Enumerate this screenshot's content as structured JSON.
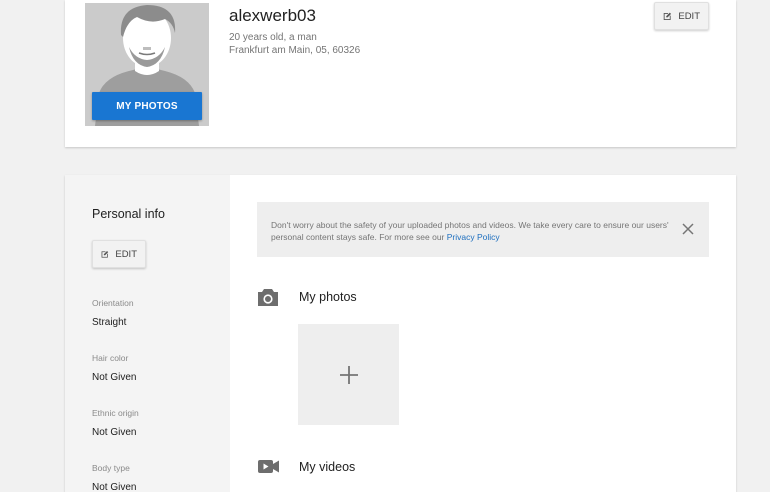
{
  "profile": {
    "username": "alexwerb03",
    "age_gender": "20 years old, a man",
    "location": "Frankfurt am Main, 05, 60326",
    "my_photos_label": "MY PHOTOS",
    "edit_label": "EDIT"
  },
  "personal_info": {
    "title": "Personal info",
    "edit_label": "EDIT",
    "fields": [
      {
        "label": "Orientation",
        "value": "Straight"
      },
      {
        "label": "Hair color",
        "value": "Not Given"
      },
      {
        "label": "Ethnic origin",
        "value": "Not Given"
      },
      {
        "label": "Body type",
        "value": "Not Given"
      }
    ]
  },
  "notice": {
    "text": "Don't worry about the safety of your uploaded photos and videos. We take every care to ensure our users' personal content stays safe. For more see our ",
    "link": "Privacy Policy"
  },
  "sections": {
    "photos_title": "My photos",
    "videos_title": "My videos"
  },
  "icons": [
    "edit-icon",
    "camera-icon",
    "video-camera-icon",
    "close-icon",
    "plus-icon"
  ],
  "colors": {
    "accent": "#1976d2",
    "link": "#1e6fbf",
    "background": "#f1f1f1"
  }
}
